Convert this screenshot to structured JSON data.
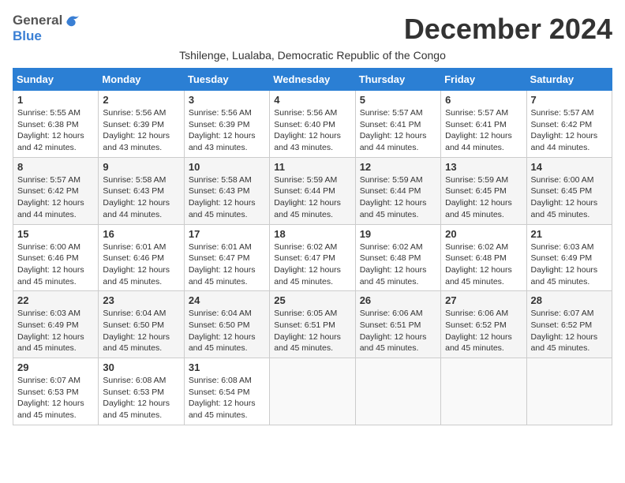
{
  "header": {
    "logo_general": "General",
    "logo_blue": "Blue",
    "month": "December 2024",
    "subtitle": "Tshilenge, Lualaba, Democratic Republic of the Congo"
  },
  "weekdays": [
    "Sunday",
    "Monday",
    "Tuesday",
    "Wednesday",
    "Thursday",
    "Friday",
    "Saturday"
  ],
  "weeks": [
    [
      {
        "day": "1",
        "sunrise": "5:55 AM",
        "sunset": "6:38 PM",
        "daylight": "12 hours and 42 minutes."
      },
      {
        "day": "2",
        "sunrise": "5:56 AM",
        "sunset": "6:39 PM",
        "daylight": "12 hours and 43 minutes."
      },
      {
        "day": "3",
        "sunrise": "5:56 AM",
        "sunset": "6:39 PM",
        "daylight": "12 hours and 43 minutes."
      },
      {
        "day": "4",
        "sunrise": "5:56 AM",
        "sunset": "6:40 PM",
        "daylight": "12 hours and 43 minutes."
      },
      {
        "day": "5",
        "sunrise": "5:57 AM",
        "sunset": "6:41 PM",
        "daylight": "12 hours and 44 minutes."
      },
      {
        "day": "6",
        "sunrise": "5:57 AM",
        "sunset": "6:41 PM",
        "daylight": "12 hours and 44 minutes."
      },
      {
        "day": "7",
        "sunrise": "5:57 AM",
        "sunset": "6:42 PM",
        "daylight": "12 hours and 44 minutes."
      }
    ],
    [
      {
        "day": "8",
        "sunrise": "5:57 AM",
        "sunset": "6:42 PM",
        "daylight": "12 hours and 44 minutes."
      },
      {
        "day": "9",
        "sunrise": "5:58 AM",
        "sunset": "6:43 PM",
        "daylight": "12 hours and 44 minutes."
      },
      {
        "day": "10",
        "sunrise": "5:58 AM",
        "sunset": "6:43 PM",
        "daylight": "12 hours and 45 minutes."
      },
      {
        "day": "11",
        "sunrise": "5:59 AM",
        "sunset": "6:44 PM",
        "daylight": "12 hours and 45 minutes."
      },
      {
        "day": "12",
        "sunrise": "5:59 AM",
        "sunset": "6:44 PM",
        "daylight": "12 hours and 45 minutes."
      },
      {
        "day": "13",
        "sunrise": "5:59 AM",
        "sunset": "6:45 PM",
        "daylight": "12 hours and 45 minutes."
      },
      {
        "day": "14",
        "sunrise": "6:00 AM",
        "sunset": "6:45 PM",
        "daylight": "12 hours and 45 minutes."
      }
    ],
    [
      {
        "day": "15",
        "sunrise": "6:00 AM",
        "sunset": "6:46 PM",
        "daylight": "12 hours and 45 minutes."
      },
      {
        "day": "16",
        "sunrise": "6:01 AM",
        "sunset": "6:46 PM",
        "daylight": "12 hours and 45 minutes."
      },
      {
        "day": "17",
        "sunrise": "6:01 AM",
        "sunset": "6:47 PM",
        "daylight": "12 hours and 45 minutes."
      },
      {
        "day": "18",
        "sunrise": "6:02 AM",
        "sunset": "6:47 PM",
        "daylight": "12 hours and 45 minutes."
      },
      {
        "day": "19",
        "sunrise": "6:02 AM",
        "sunset": "6:48 PM",
        "daylight": "12 hours and 45 minutes."
      },
      {
        "day": "20",
        "sunrise": "6:02 AM",
        "sunset": "6:48 PM",
        "daylight": "12 hours and 45 minutes."
      },
      {
        "day": "21",
        "sunrise": "6:03 AM",
        "sunset": "6:49 PM",
        "daylight": "12 hours and 45 minutes."
      }
    ],
    [
      {
        "day": "22",
        "sunrise": "6:03 AM",
        "sunset": "6:49 PM",
        "daylight": "12 hours and 45 minutes."
      },
      {
        "day": "23",
        "sunrise": "6:04 AM",
        "sunset": "6:50 PM",
        "daylight": "12 hours and 45 minutes."
      },
      {
        "day": "24",
        "sunrise": "6:04 AM",
        "sunset": "6:50 PM",
        "daylight": "12 hours and 45 minutes."
      },
      {
        "day": "25",
        "sunrise": "6:05 AM",
        "sunset": "6:51 PM",
        "daylight": "12 hours and 45 minutes."
      },
      {
        "day": "26",
        "sunrise": "6:06 AM",
        "sunset": "6:51 PM",
        "daylight": "12 hours and 45 minutes."
      },
      {
        "day": "27",
        "sunrise": "6:06 AM",
        "sunset": "6:52 PM",
        "daylight": "12 hours and 45 minutes."
      },
      {
        "day": "28",
        "sunrise": "6:07 AM",
        "sunset": "6:52 PM",
        "daylight": "12 hours and 45 minutes."
      }
    ],
    [
      {
        "day": "29",
        "sunrise": "6:07 AM",
        "sunset": "6:53 PM",
        "daylight": "12 hours and 45 minutes."
      },
      {
        "day": "30",
        "sunrise": "6:08 AM",
        "sunset": "6:53 PM",
        "daylight": "12 hours and 45 minutes."
      },
      {
        "day": "31",
        "sunrise": "6:08 AM",
        "sunset": "6:54 PM",
        "daylight": "12 hours and 45 minutes."
      },
      null,
      null,
      null,
      null
    ]
  ]
}
